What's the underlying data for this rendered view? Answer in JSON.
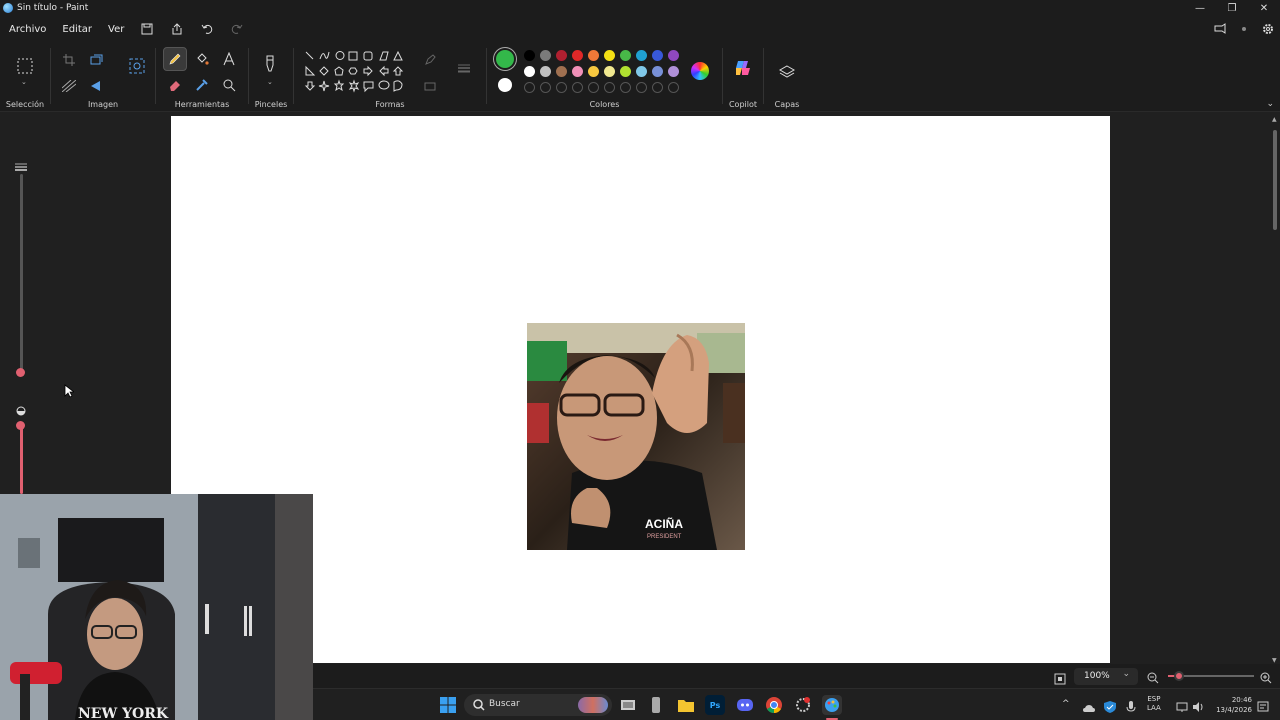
{
  "window": {
    "title": "Sin título - Paint",
    "min": "—",
    "max": "❐",
    "close": "✕"
  },
  "menu": {
    "file": "Archivo",
    "edit": "Editar",
    "view": "Ver"
  },
  "ribbon": {
    "selection": "Selección",
    "image": "Imagen",
    "tools": "Herramientas",
    "brushes": "Pinceles",
    "shapes": "Formas",
    "colors": "Colores",
    "copilot": "Copilot",
    "layers": "Capas"
  },
  "palette": {
    "primary": "#33b84a",
    "secondary": "#ffffff",
    "row1": [
      "#000000",
      "#7a7a7a",
      "#b02030",
      "#e02828",
      "#f07838",
      "#f4e014",
      "#48b848",
      "#20a0d0",
      "#3858d8",
      "#9048c0"
    ],
    "row2": [
      "#ffffff",
      "#c0c0c0",
      "#a07050",
      "#f090b8",
      "#f8c840",
      "#f0e890",
      "#b0e030",
      "#80c8e8",
      "#7890d8",
      "#b090d8"
    ]
  },
  "status": {
    "zoom": "100%"
  },
  "taskbar": {
    "search": "Buscar",
    "lang": "ESP",
    "lang2": "LAA",
    "time": "20:46",
    "date": "13/4/2026"
  },
  "photo": {
    "shirt_text": "ACIÑA",
    "shirt_text2": "PRESIDENT"
  },
  "webcam": {
    "hoodie_text": "NEW YORK"
  }
}
